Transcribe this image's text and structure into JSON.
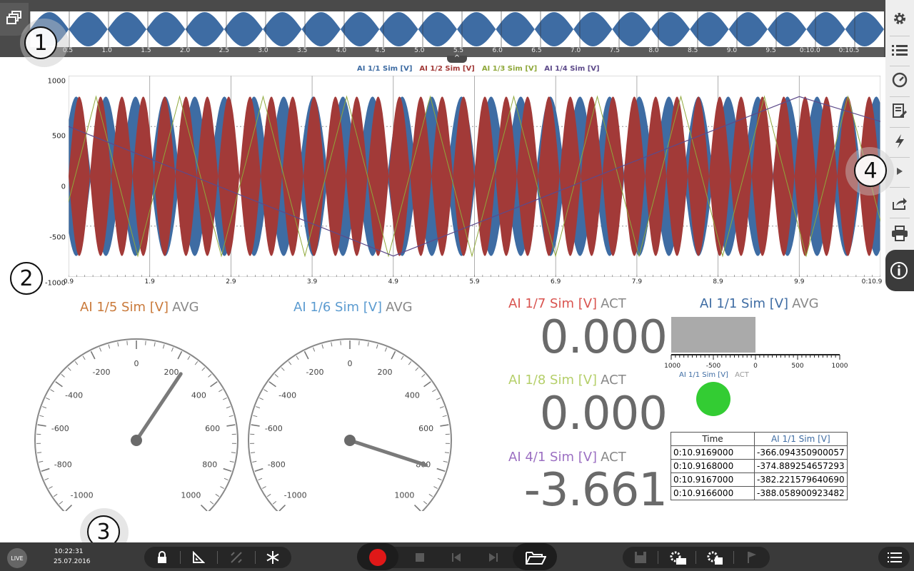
{
  "overview": {
    "ticks": [
      "0.5",
      "1.0",
      "1.5",
      "2.0",
      "2.5",
      "3.0",
      "3.5",
      "4.0",
      "4.5",
      "5.0",
      "5.5",
      "6.0",
      "6.5",
      "7.0",
      "7.5",
      "8.0",
      "8.5",
      "9.0",
      "9.5",
      "0:10.0",
      "0:10.5"
    ],
    "handle_glyph": "^"
  },
  "callouts": [
    "1",
    "2",
    "3",
    "4"
  ],
  "sidebar": {
    "icons": [
      "gear-icon",
      "list-icon",
      "gauge-icon",
      "report-icon",
      "lightning-icon",
      "expand-arrow-icon",
      "share-icon",
      "print-icon",
      "info-icon"
    ]
  },
  "recorder": {
    "legend": [
      {
        "label": "AI 1/1 Sim [V]",
        "color": "#3e6ca3"
      },
      {
        "label": "AI 1/2 Sim [V]",
        "color": "#a23a38"
      },
      {
        "label": "AI 1/3 Sim [V]",
        "color": "#8fa83a"
      },
      {
        "label": "AI 1/4 Sim [V]",
        "color": "#5d4a8a"
      }
    ],
    "y_ticks": [
      "1000",
      "500",
      "0",
      "-500",
      "-1000"
    ],
    "x_ticks": [
      "0.9",
      "1.9",
      "2.9",
      "3.9",
      "4.9",
      "5.9",
      "6.9",
      "7.9",
      "8.9",
      "9.9",
      "0:10.9"
    ]
  },
  "chart_data": {
    "type": "line",
    "ylim": [
      -1000,
      1000
    ],
    "x_start": 0.9,
    "x_end": 10.9,
    "series": [
      {
        "name": "AI 1/1 Sim [V]",
        "color": "#3e6ca3",
        "envelope_amplitude": 800
      },
      {
        "name": "AI 1/2 Sim [V]",
        "color": "#a23a38",
        "envelope_amplitude": 800
      },
      {
        "name": "AI 1/3 Sim [V]",
        "color": "#8fa83a",
        "triangle_amplitude": 800
      },
      {
        "name": "AI 1/4 Sim [V]",
        "color": "#5d4a8a",
        "triangle_amplitude": 800
      }
    ]
  },
  "gauges": [
    {
      "title": "AI 1/5 Sim [V]",
      "mode": "AVG",
      "title_color": "#c9793a",
      "value": 250,
      "labels": [
        "-1000",
        "-800",
        "-600",
        "-400",
        "-200",
        "0",
        "200",
        "400",
        "600",
        "800",
        "1000"
      ]
    },
    {
      "title": "AI 1/6 Sim [V]",
      "mode": "AVG",
      "title_color": "#5b9bd0",
      "value": 800,
      "labels": [
        "-1000",
        "-800",
        "-600",
        "-400",
        "-200",
        "0",
        "200",
        "400",
        "600",
        "800",
        "1000"
      ]
    }
  ],
  "digitals": [
    {
      "title": "AI 1/7 Sim [V]",
      "mode": "ACT",
      "title_color": "#d9534f",
      "value": "0.000"
    },
    {
      "title": "AI 1/8 Sim [V]",
      "mode": "ACT",
      "title_color": "#b5cf6a",
      "value": "0.000"
    },
    {
      "title": "AI 4/1 Sim [V]",
      "mode": "ACT",
      "title_color": "#9b6fc2",
      "value": "-3.661"
    }
  ],
  "bargraph": {
    "title": "AI 1/1 Sim [V]",
    "mode": "AVG",
    "title_color": "#3e6ca3",
    "ticks": [
      "-1000",
      "-500",
      "0",
      "500",
      "1000"
    ],
    "value": 0
  },
  "led": {
    "title": "AI 1/1 Sim [V]",
    "mode": "ACT",
    "color": "#33cc33"
  },
  "table": {
    "headers": [
      "Time",
      "AI 1/1 Sim [V]"
    ],
    "rows": [
      [
        "0:10.9169000",
        "-366.094350900057"
      ],
      [
        "0:10.9168000",
        "-374.889254657293"
      ],
      [
        "0:10.9167000",
        "-382.221579640690"
      ],
      [
        "0:10.9166000",
        "-388.058900923482"
      ]
    ]
  },
  "bottom": {
    "live_label": "LIVE",
    "time": "10:22:31",
    "date": "25.07.2016"
  }
}
